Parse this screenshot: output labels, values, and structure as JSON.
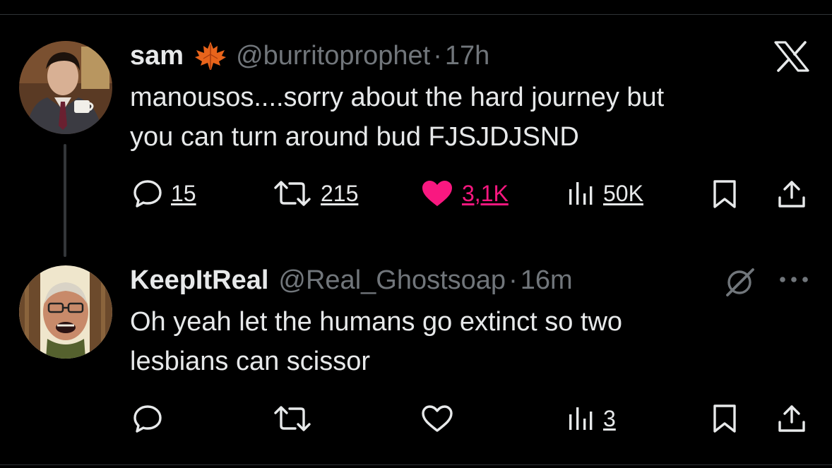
{
  "thread": {
    "parent": {
      "display_name": "sam",
      "badge_icon": "maple-leaf-emoji",
      "handle": "@burritoprophet",
      "separator": "·",
      "time": "17h",
      "text_line1": "manousos....sorry about the hard journey but",
      "text_line2": "you can turn around bud FJSJDJSND",
      "replies": "15",
      "reposts": "215",
      "likes": "3,1K",
      "views": "50K",
      "liked": true
    },
    "reply": {
      "display_name": "KeepItReal",
      "handle": "@Real_Ghostsoap",
      "separator": "·",
      "time": "16m",
      "text_line1": "Oh yeah let the humans go extinct so two",
      "text_line2": "lesbians can scissor",
      "replies": "",
      "reposts": "",
      "likes": "",
      "views": "3",
      "liked": false
    }
  },
  "icons": {
    "brand": "x-logo-icon",
    "reply": "speech-bubble-icon",
    "repost": "repost-arrows-icon",
    "like": "heart-icon",
    "views": "bar-chart-icon",
    "bookmark": "bookmark-icon",
    "share": "share-upload-icon",
    "grok": "grok-slash-icon",
    "more": "more-dots-icon"
  },
  "colors": {
    "background": "#000000",
    "primary_text": "#e7e9ea",
    "secondary_text": "#71767b",
    "like_pink": "#f91880",
    "divider": "#2f3336"
  }
}
